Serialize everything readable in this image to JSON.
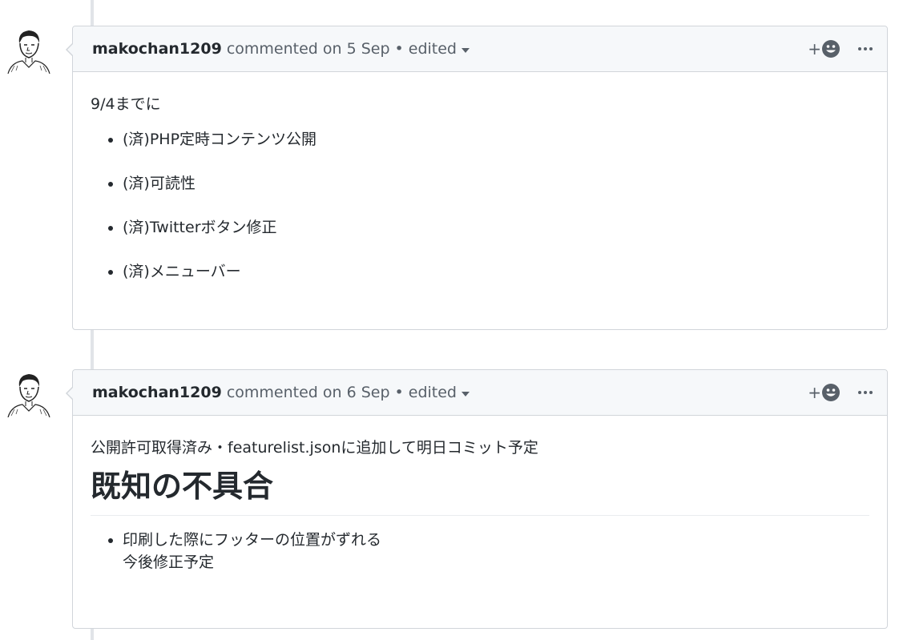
{
  "comments": [
    {
      "author": "makochan1209",
      "header_text": "commented on 5 Sep",
      "separator": "•",
      "edited_label": "edited",
      "reaction_plus": "+",
      "body_intro": "9/4までに",
      "items": [
        "(済)PHP定時コンテンツ公開",
        "(済)可読性",
        "(済)Twitterボタン修正",
        "(済)メニューバー"
      ]
    },
    {
      "author": "makochan1209",
      "header_text": "commented on 6 Sep",
      "separator": "•",
      "edited_label": "edited",
      "reaction_plus": "+",
      "body_intro": "公開許可取得済み・featurelist.jsonに追加して明日コミット予定",
      "heading": "既知の不具合",
      "items": [
        [
          "印刷した際にフッターの位置がずれる",
          "今後修正予定"
        ]
      ]
    }
  ],
  "icons": {
    "reaction": "smiley-icon",
    "more": "kebab-horizontal-icon",
    "caret": "caret-down-icon"
  },
  "colors": {
    "header_bg": "#f6f8fa",
    "border": "#d1d5da",
    "text": "#24292e",
    "muted": "#586069"
  }
}
